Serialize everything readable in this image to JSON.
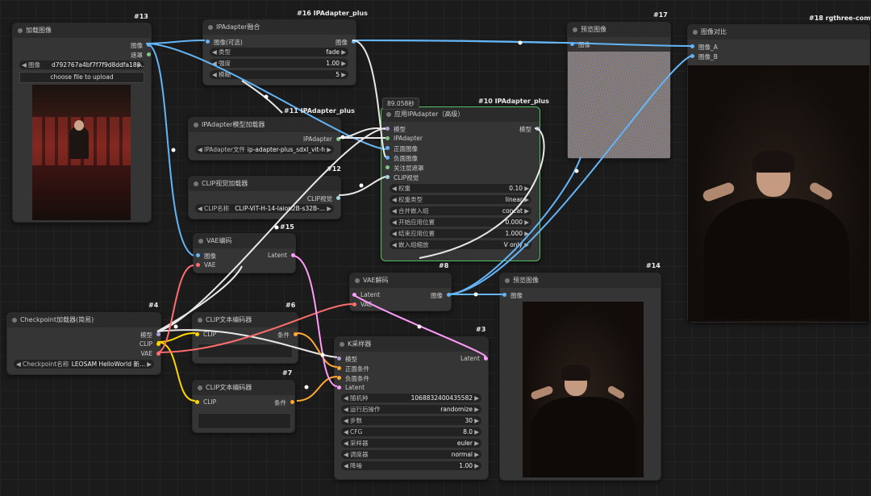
{
  "colors": {
    "image": "#64b5f6",
    "model": "#b39ddb",
    "clip": "#ffd500",
    "vae": "#ff6e6e",
    "latent": "#ff9cf9",
    "conditioning": "#ffa931",
    "ipadapter": "#ffffff",
    "clip_vision": "#a8dadc",
    "selected": "#58c060"
  },
  "nodes": {
    "load_image": {
      "id": "#13",
      "title": "加载图像",
      "out_image": "图像",
      "out_mask": "遮罩",
      "w_image_label": "图像",
      "w_image_value": "d792767a4bf7f7f9d8ddfa180...",
      "upload": "choose file to upload"
    },
    "ipa_tiled": {
      "id": "#16 IPAdapter_plus",
      "title": "IPAdapter融合",
      "in_image": "图像(可选)",
      "out_image": "图像",
      "widgets": [
        {
          "l": "类型",
          "v": "fade"
        },
        {
          "l": "强度",
          "v": "1.00"
        },
        {
          "l": "模糊",
          "v": "5"
        }
      ]
    },
    "ipa_loader": {
      "id": "#11 IPAdapter_plus",
      "title": "IPAdapter模型加载器",
      "out": "IPAdapter",
      "w_label": "IPAdapter文件",
      "w_value": "ip-adapter-plus_sdxl_vit-h"
    },
    "clip_vision": {
      "id": "#12",
      "title": "CLIP视觉加载器",
      "out": "CLIP视觉",
      "w_label": "CLIP名称",
      "w_value": "CLIP-ViT-H-14-laion2B-s32B-..."
    },
    "apply_ipa": {
      "id": "#10 IPAdapter_plus",
      "timer": "89.058秒",
      "title": "应用IPAdapter（高级）",
      "out": "模型",
      "inputs": [
        "模型",
        "IPAdapter",
        "正面图像",
        "负面图像",
        "关注层遮罩",
        "CLIP视觉"
      ],
      "widgets": [
        {
          "l": "权重",
          "v": "0.10"
        },
        {
          "l": "权重类型",
          "v": "linear"
        },
        {
          "l": "合并嵌入组",
          "v": "concat"
        },
        {
          "l": "开始应用位置",
          "v": "0.000"
        },
        {
          "l": "结束应用位置",
          "v": "1.000"
        },
        {
          "l": "嵌入组缩放",
          "v": "V only"
        }
      ]
    },
    "preview17": {
      "id": "#17",
      "title": "预览图像",
      "in": "图像"
    },
    "compare": {
      "id": "#18 rgthree-comfy",
      "title": "图像对比",
      "in_a": "图像_A",
      "in_b": "图像_B"
    },
    "vae_encode": {
      "id": "#15",
      "title": "VAE编码",
      "in_image": "图像",
      "in_vae": "VAE",
      "out": "Latent"
    },
    "checkpoint": {
      "id": "#4",
      "title": "Checkpoint加载器(简易)",
      "out_model": "模型",
      "out_clip": "CLIP",
      "out_vae": "VAE",
      "w_label": "Checkpoint名称",
      "w_value": "LEOSAM HelloWorld 新..."
    },
    "clip6": {
      "id": "#6",
      "title": "CLIP文本编码器",
      "in": "CLIP",
      "out": "条件"
    },
    "clip7": {
      "id": "#7",
      "title": "CLIP文本编码器",
      "in": "CLIP",
      "out": "条件"
    },
    "vae_decode": {
      "id": "#8",
      "title": "VAE解码",
      "in_latent": "Latent",
      "in_vae": "VAE",
      "out": "图像"
    },
    "ksampler": {
      "id": "#3",
      "title": "K采样器",
      "out": "Latent",
      "inputs": [
        "模型",
        "正面条件",
        "负面条件",
        "Latent"
      ],
      "widgets": [
        {
          "l": "随机种",
          "v": "1068832400435582"
        },
        {
          "l": "运行后操作",
          "v": "randomize"
        },
        {
          "l": "步数",
          "v": "30"
        },
        {
          "l": "CFG",
          "v": "8.0"
        },
        {
          "l": "采样器",
          "v": "euler"
        },
        {
          "l": "调度器",
          "v": "normal"
        },
        {
          "l": "降噪",
          "v": "1.00"
        }
      ]
    },
    "preview14": {
      "id": "#14",
      "title": "预览图像",
      "in": "图像"
    }
  }
}
